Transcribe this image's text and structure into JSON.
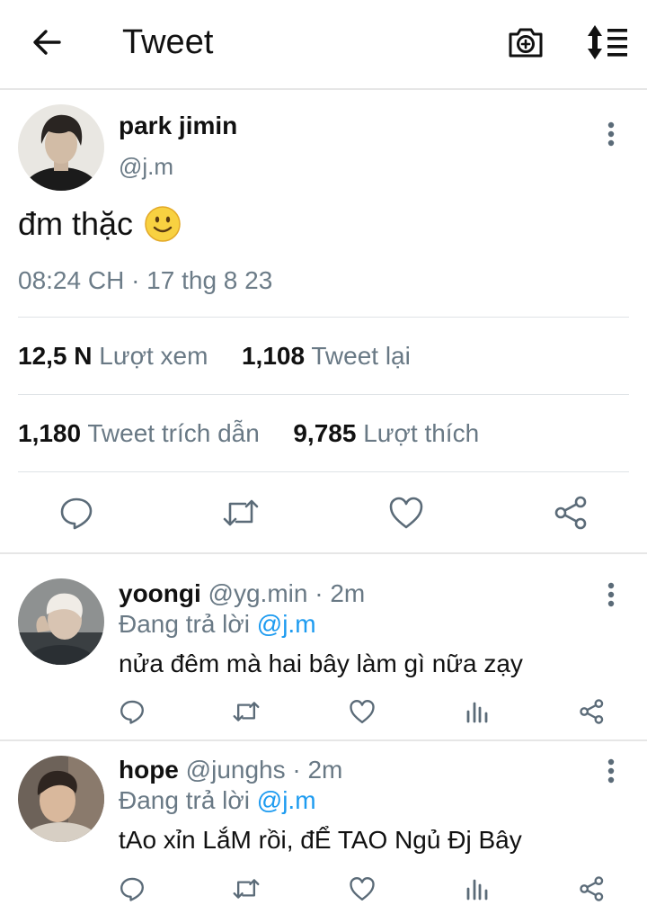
{
  "header": {
    "title": "Tweet",
    "back_icon": "arrow-left-icon",
    "camera_icon": "camera-add-icon",
    "sort_icon": "sort-lines-icon"
  },
  "tweet": {
    "author_name": "park jimin",
    "author_handle": "@j.m",
    "text": "đm thặc",
    "emoji": "slightly-smiling-face",
    "meta": "08:24 CH · 17 thg 8 23",
    "views_count": "12,5 N",
    "views_label": "Lượt xem",
    "retweets_count": "1,108",
    "retweets_label": "Tweet lại",
    "quotes_count": "1,180",
    "quotes_label": "Tweet trích dẫn",
    "likes_count": "9,785",
    "likes_label": "Lượt thích"
  },
  "replies": [
    {
      "name": "yoongi",
      "handle": "@yg.min · 2m",
      "replying_prefix": "Đang trả lời",
      "replying_to": "@j.m",
      "text": "nửa đêm mà hai bây làm gì nữa zạy"
    },
    {
      "name": "hope",
      "handle": "@junghs · 2m",
      "replying_prefix": "Đang trả lời",
      "replying_to": "@j.m",
      "text": "tAo xỉn LắM rồi, đỂ TAO Ngủ Đj Bây"
    }
  ],
  "colors": {
    "accent": "#1d9bf0",
    "secondary_text": "#697985",
    "icon_gray": "#5b6b78",
    "divider": "#dfe3e6"
  }
}
